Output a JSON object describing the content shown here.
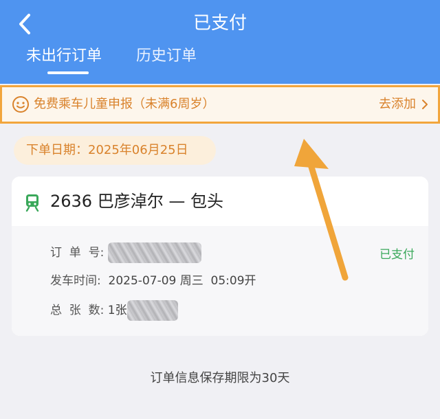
{
  "header": {
    "title": "已支付",
    "tabs": [
      {
        "label": "未出行订单",
        "active": true
      },
      {
        "label": "历史订单",
        "active": false
      }
    ],
    "color": "#4f94f0"
  },
  "notice": {
    "text": "免费乘车儿童申报（未满6周岁）",
    "action": "去添加",
    "icon": "smiley-icon",
    "highlight_color": "#f2a53c"
  },
  "order_date": {
    "label": "下单日期：",
    "value": "2025年06月25日"
  },
  "order_card": {
    "train_icon": "train-icon",
    "title": "2636 巴彦淖尔 — 包头",
    "status": "已支付",
    "status_color": "#3aa85a",
    "order_no_label": "订  单  号:",
    "departure_label": "发车时间:",
    "departure_value": "2025-07-09 周三  05:09开",
    "ticket_count_label": "总  张  数:",
    "ticket_count_value": "1张"
  },
  "footer": {
    "note": "订单信息保存期限为30天"
  }
}
